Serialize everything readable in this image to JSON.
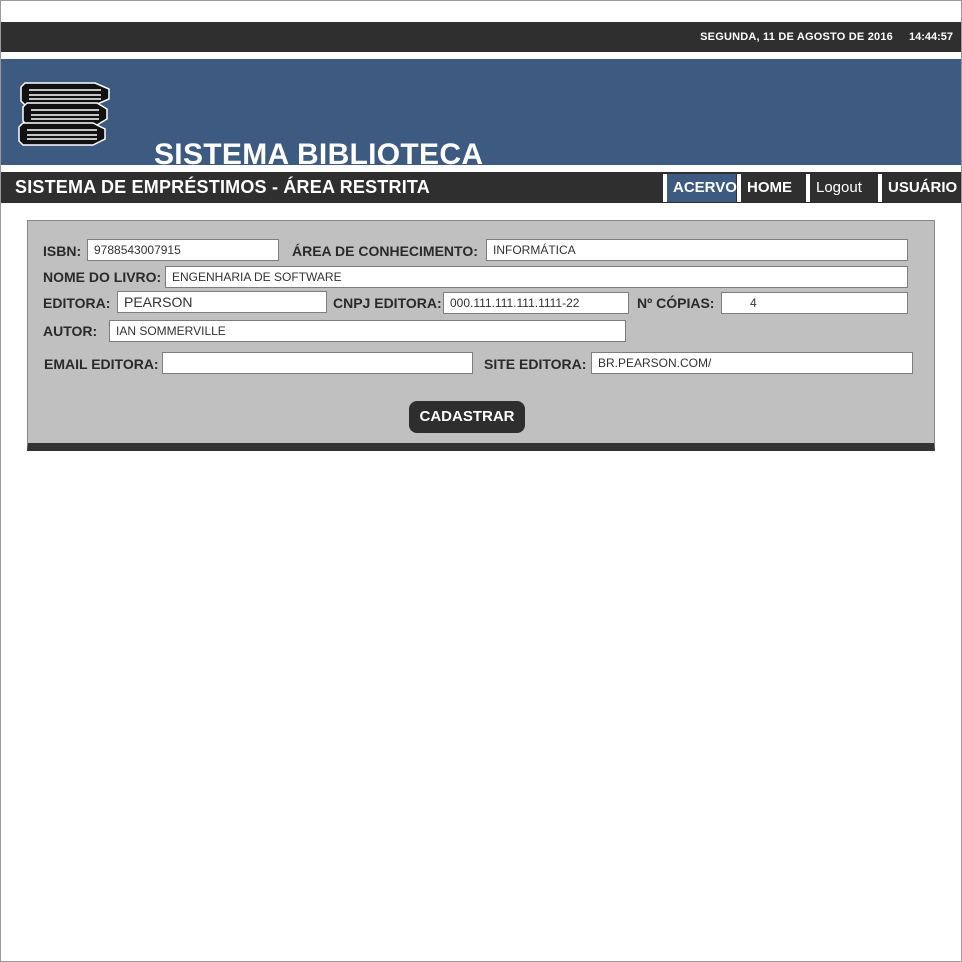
{
  "header": {
    "date": "SEGUNDA, 11 DE AGOSTO DE 2016",
    "time": "14:44:57"
  },
  "banner": {
    "logo_icon": "books-stack-icon",
    "title": "SISTEMA BIBLIOTECA"
  },
  "nav": {
    "section_title": "SISTEMA DE EMPRÉSTIMOS - ÁREA RESTRITA",
    "items": [
      {
        "label": "ACERVO",
        "active": true
      },
      {
        "label": "HOME"
      },
      {
        "label": "Logout"
      },
      {
        "label": "USUÁRIO"
      }
    ]
  },
  "form": {
    "isbn": {
      "label": "ISBN:",
      "value": "9788543007915"
    },
    "area": {
      "label": "ÁREA DE CONHECIMENTO:",
      "value": "INFORMÁTICA"
    },
    "nome": {
      "label": "NOME DO LIVRO:",
      "value": "ENGENHARIA DE SOFTWARE"
    },
    "editora": {
      "label": "EDITORA:",
      "value": "PEARSON"
    },
    "cnpj": {
      "label": "CNPJ EDITORA:",
      "value": "000.111.111.111.1111-22"
    },
    "copias": {
      "label": "Nº CÓPIAS:",
      "value": "4"
    },
    "autor": {
      "label": "AUTOR:",
      "value": "IAN SOMMERVILLE"
    },
    "email": {
      "label": "EMAIL EDITORA:",
      "value": ""
    },
    "site": {
      "label": "SITE EDITORA:",
      "value": "BR.PEARSON.COM/"
    },
    "submit_label": "CADASTRAR"
  },
  "colors": {
    "dark_bar": "#2f2f30",
    "brand_blue": "#3d5a80",
    "panel_gray": "#c0c0c1"
  }
}
